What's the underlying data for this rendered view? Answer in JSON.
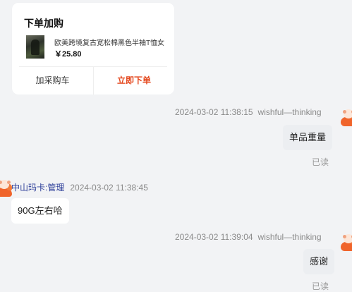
{
  "order_card": {
    "title": "下单加购",
    "product_name": "欧美跨境复古宽松棉黑色半袖T恤女",
    "price": "￥25.80",
    "add_cart_label": "加采购车",
    "buy_now_label": "立即下单",
    "accent_color": "#e4471d"
  },
  "messages": [
    {
      "side": "right",
      "time": "2024-03-02 11:38:15",
      "sender": "wishful—thinking",
      "text": "单品重量",
      "status": "已读"
    },
    {
      "side": "left",
      "sender": "中山玛卡:管理",
      "time": "2024-03-02 11:38:45",
      "text": "90G左右哈"
    },
    {
      "side": "right",
      "time": "2024-03-02 11:39:04",
      "sender": "wishful—thinking",
      "text": "感谢",
      "status": "已读"
    }
  ],
  "icons": {
    "own_avatar": "cartoon-fox-avatar-icon",
    "other_avatar": "cartoon-fox-avatar-icon",
    "product_thumbnail": "product-photo"
  }
}
